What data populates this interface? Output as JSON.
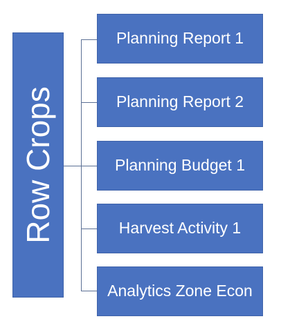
{
  "diagram": {
    "root": {
      "label": "Row Crops"
    },
    "children": [
      {
        "label": "Planning Report 1"
      },
      {
        "label": "Planning Report 2"
      },
      {
        "label": "Planning Budget 1"
      },
      {
        "label": "Harvest Activity 1"
      },
      {
        "label": "Analytics Zone Econ"
      }
    ]
  },
  "colors": {
    "box_fill": "#4a72c0",
    "box_border": "#3e62a9",
    "connector": "#5a6f94",
    "text": "#ffffff"
  }
}
